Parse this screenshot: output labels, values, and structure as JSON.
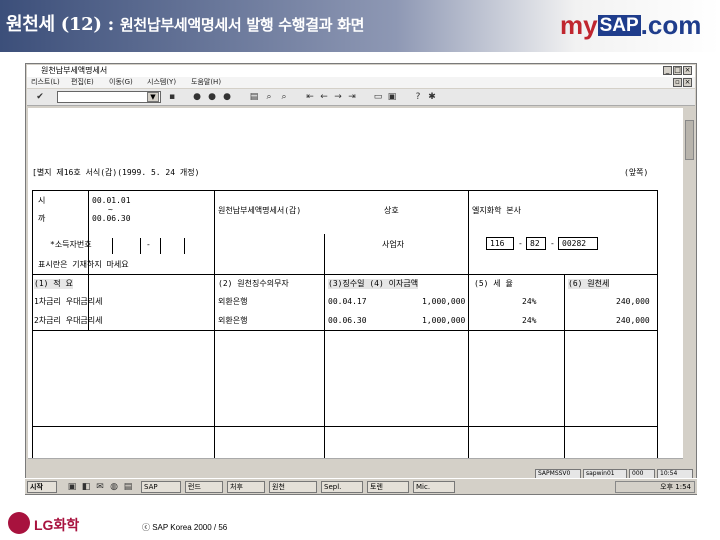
{
  "slide": {
    "title_main": "원천세 (12) : ",
    "title_sub": "원천납부세액명세서 발행 수행결과 화면",
    "logo": {
      "my": "my",
      "sap": "SAP",
      "com": ".com"
    },
    "footer_company": "LG화학",
    "footer_copyright": "ⓒ SAP Korea 2000 / 56"
  },
  "window": {
    "title": "원천납부세액명세서",
    "menu": [
      "리스트(L)",
      "편집(E)",
      "이동(G)",
      "시스템(Y)",
      "도움말(H)"
    ],
    "command_field": "",
    "statusbar": [
      "SAPMSSV0",
      "sapwin01",
      "000",
      "10:54"
    ]
  },
  "report": {
    "heading_left": "[별지 제16호 서식(갑)(1999. 5. 24 개정)",
    "heading_right": "(앞쪽)",
    "period_label_from": "시",
    "period_from": "00.01.01",
    "period_tilde": "~",
    "period_label_to": "까",
    "period_to": "00.06.30",
    "doc_title": "원천납부세액명세서(갑)",
    "field_corp": "상호",
    "field_corp_value": "엘지화학 본사",
    "reg_label": "*소득자번호",
    "reg_dash": "-",
    "biz_label": "사업자",
    "biz_no": [
      "116",
      "82",
      "00282"
    ],
    "note": "표시란은 기재하지 마세요",
    "columns": [
      "(1) 적 요",
      "(2) 원천징수의무자",
      "(3)징수일 (4) 이자금액",
      "(5) 세 율",
      "(6) 원천세"
    ],
    "rows": [
      {
        "item": "1차금리 우대금리세",
        "payer": "외환은행",
        "date": "00.04.17",
        "amount": "1,000,000",
        "rate": "24%",
        "tax": "240,000"
      },
      {
        "item": "2차금리 우대금리세",
        "payer": "외환은행",
        "date": "00.06.30",
        "amount": "1,000,000",
        "rate": "24%",
        "tax": "240,000"
      }
    ]
  },
  "taskbar": {
    "start": "시작",
    "tasks": [
      "SAP",
      "런드",
      "처후",
      "원천",
      "Sepl.",
      "토렌",
      "Mic."
    ],
    "tray": "오후 1:54"
  },
  "colors": {
    "header_dark": "#3c4f7a",
    "lg_red": "#a8123e",
    "sap_blue": "#1f3d8c"
  }
}
